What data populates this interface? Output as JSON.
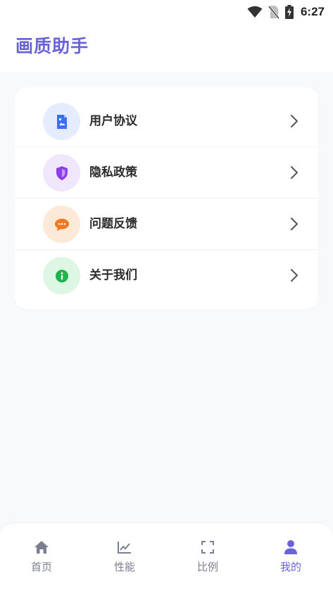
{
  "status_bar": {
    "time": "6:27",
    "icons": [
      "wifi-icon",
      "no-sim-icon",
      "battery-charging-icon"
    ]
  },
  "header": {
    "title": "画质助手"
  },
  "menu": {
    "items": [
      {
        "label": "用户协议",
        "icon": "document-icon",
        "icon_color": "#3b6ff5",
        "bg_color": "#e4ecfd"
      },
      {
        "label": "隐私政策",
        "icon": "shield-icon",
        "icon_color": "#8b3fe8",
        "bg_color": "#f1e7fd"
      },
      {
        "label": "问题反馈",
        "icon": "chat-icon",
        "icon_color": "#f3781f",
        "bg_color": "#fde9d7"
      },
      {
        "label": "关于我们",
        "icon": "info-icon",
        "icon_color": "#1fb34e",
        "bg_color": "#ddf7e4"
      }
    ]
  },
  "tabbar": {
    "active_color": "#6a63d8",
    "inactive_color": "#7a7f91",
    "tabs": [
      {
        "label": "首页",
        "icon": "home-icon",
        "active": false
      },
      {
        "label": "性能",
        "icon": "chart-icon",
        "active": false
      },
      {
        "label": "比例",
        "icon": "fullscreen-icon",
        "active": false
      },
      {
        "label": "我的",
        "icon": "user-icon",
        "active": true
      }
    ]
  }
}
